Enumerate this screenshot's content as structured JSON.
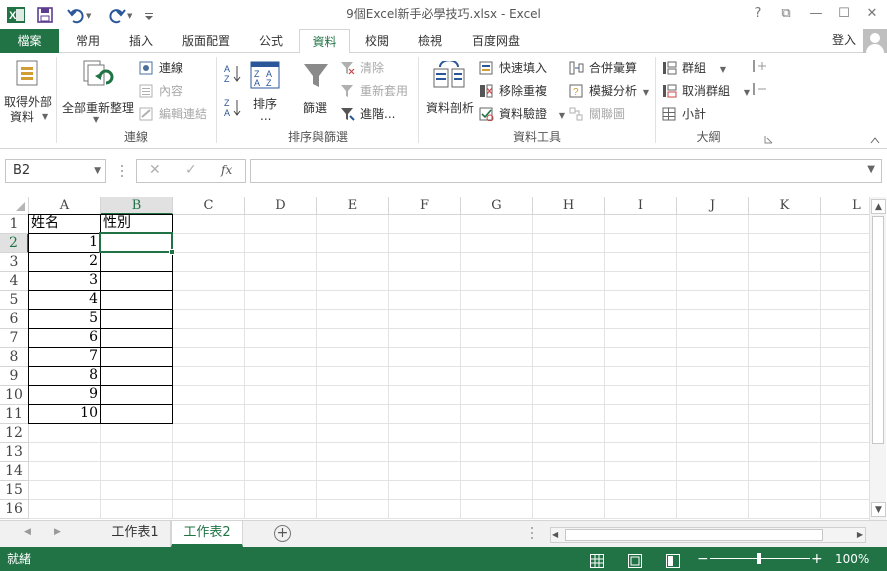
{
  "window": {
    "title": "9個Excel新手必學技巧.xlsx - Excel",
    "help": "?",
    "restore_ribbon": "⧉",
    "minimize": "—",
    "maximize": "☐",
    "close": "✕"
  },
  "tabs": [
    "檔案",
    "常用",
    "插入",
    "版面配置",
    "公式",
    "資料",
    "校閱",
    "檢視",
    "百度网盘"
  ],
  "signin": "登入",
  "ribbon": {
    "get_external": "取得外部",
    "get_external2": "資料",
    "refresh_all": "全部重新整理",
    "connections": "連線",
    "properties": "內容",
    "edit_links": "編輯連結",
    "group_connections": "連線",
    "sort_az": "A↓Z",
    "sort": "排序",
    "sort_more": "...",
    "filter": "篩選",
    "clear": "清除",
    "reapply": "重新套用",
    "advanced": "進階...",
    "group_sort": "排序與篩選",
    "text_to_columns": "資料剖析",
    "flash_fill": "快速填入",
    "remove_dup": "移除重複",
    "validation": "資料驗證",
    "consolidate": "合併彙算",
    "what_if": "模擬分析",
    "relationships": "關聯圖",
    "group_tools": "資料工具",
    "group": "群組",
    "ungroup": "取消群組",
    "subtotal": "小計",
    "group_outline": "大綱"
  },
  "formula_bar": {
    "namebox": "B2",
    "cancel": "✕",
    "enter": "✓",
    "fx": "fx",
    "value": ""
  },
  "columns": [
    "A",
    "B",
    "C",
    "D",
    "E",
    "F",
    "G",
    "H",
    "I",
    "J",
    "K",
    "L"
  ],
  "rows": [
    "1",
    "2",
    "3",
    "4",
    "5",
    "6",
    "7",
    "8",
    "9",
    "10",
    "11",
    "12",
    "13",
    "14",
    "15",
    "16"
  ],
  "cells": {
    "A1": "姓名",
    "B1": "性別",
    "A2": "1",
    "A3": "2",
    "A4": "3",
    "A5": "4",
    "A6": "5",
    "A7": "6",
    "A8": "7",
    "A9": "8",
    "A10": "9",
    "A11": "10"
  },
  "sheets": [
    "工作表1",
    "工作表2"
  ],
  "add_sheet": "+",
  "status": {
    "ready": "就緒",
    "zoom": "100%",
    "minus": "−",
    "plus": "+"
  },
  "colors": {
    "accent": "#217346"
  }
}
